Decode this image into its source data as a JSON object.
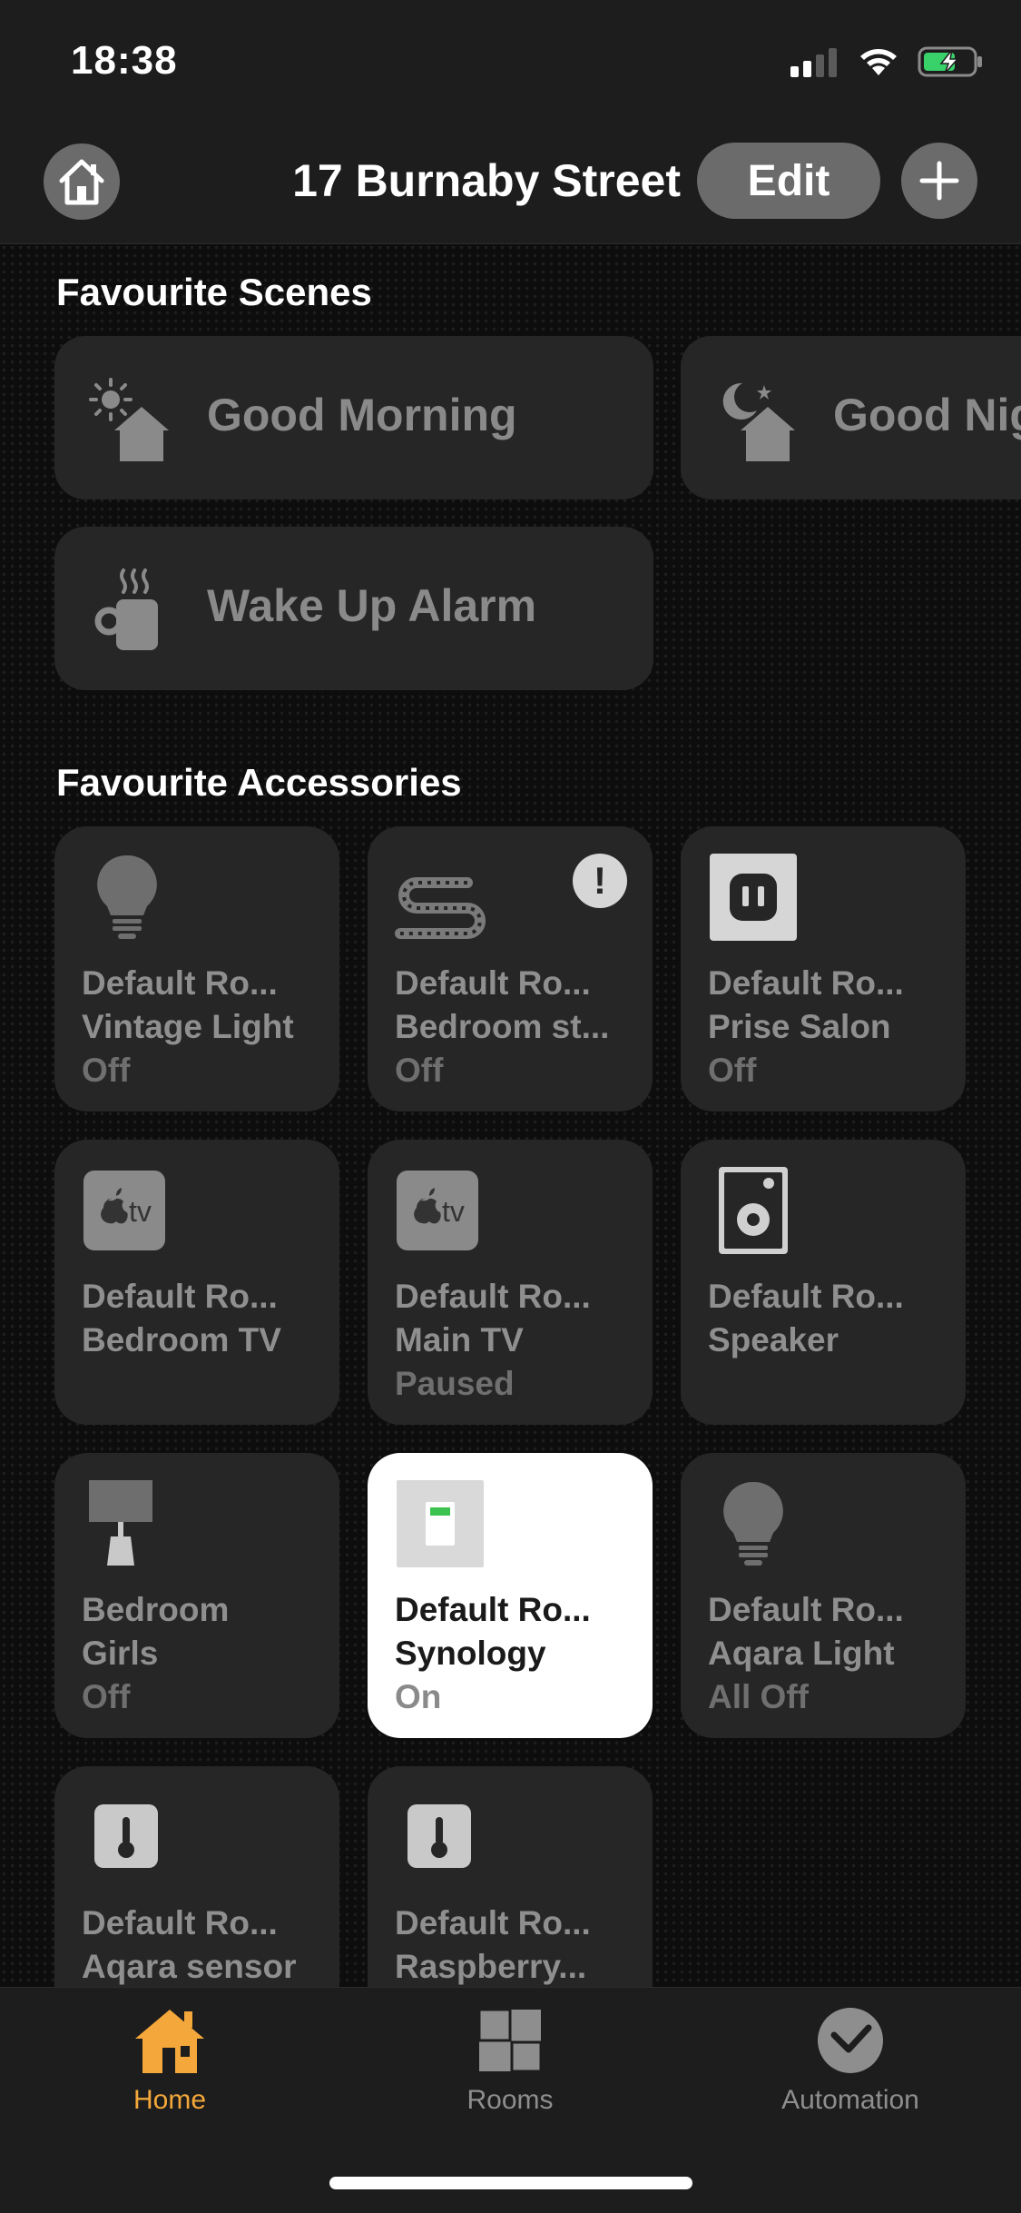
{
  "status_bar": {
    "time": "18:38"
  },
  "header": {
    "title": "17 Burnaby Street",
    "edit_label": "Edit"
  },
  "scenes": {
    "title": "Favourite Scenes",
    "items": [
      {
        "label": "Good Morning",
        "icon": "sun-house-icon"
      },
      {
        "label": "Good Nig",
        "icon": "moon-house-icon"
      },
      {
        "label": "Wake Up Alarm",
        "icon": "mug-icon"
      }
    ]
  },
  "accessories": {
    "title": "Favourite Accessories",
    "items": [
      {
        "room": "Default Ro...",
        "name": "Vintage Light",
        "status": "Off",
        "icon": "lightbulb-icon"
      },
      {
        "room": "Default Ro...",
        "name": "Bedroom st...",
        "status": "Off",
        "icon": "light-strip-icon",
        "alert": "!"
      },
      {
        "room": "Default Ro...",
        "name": "Prise Salon",
        "status": "Off",
        "icon": "outlet-icon"
      },
      {
        "room": "Default Ro...",
        "name": "Bedroom TV",
        "status": "",
        "icon": "appletv-icon",
        "tv_text": "tv"
      },
      {
        "room": "Default Ro...",
        "name": "Main TV",
        "status": "Paused",
        "icon": "appletv-icon",
        "tv_text": "tv"
      },
      {
        "room": "Default Ro...",
        "name": "Speaker",
        "status": "",
        "icon": "speaker-icon"
      },
      {
        "room": "Bedroom",
        "name": "Girls",
        "status": "Off",
        "icon": "lamp-icon"
      },
      {
        "room": "Default Ro...",
        "name": "Synology",
        "status": "On",
        "icon": "switch-icon"
      },
      {
        "room": "Default Ro...",
        "name": "Aqara Light",
        "status": "All Off",
        "icon": "lightbulb-icon"
      },
      {
        "room": "Default Ro...",
        "name": "Aqara sensor",
        "status": "",
        "icon": "thermometer-icon"
      },
      {
        "room": "Default Ro...",
        "name": "Raspberry...",
        "status": "",
        "icon": "thermometer-icon"
      }
    ]
  },
  "tabs": [
    {
      "label": "Home",
      "icon": "house-icon",
      "active": true
    },
    {
      "label": "Rooms",
      "icon": "rooms-icon",
      "active": false
    },
    {
      "label": "Automation",
      "icon": "automation-icon",
      "active": false
    }
  ],
  "colors": {
    "accent": "#f4a73a",
    "tile_bg": "#262626",
    "tile_on_bg": "#ffffff"
  }
}
